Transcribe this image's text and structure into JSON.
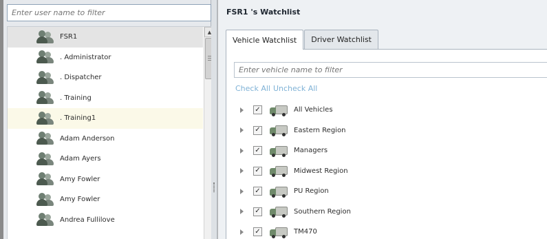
{
  "user_panel": {
    "filter_placeholder": "Enter user name to filter",
    "users": [
      {
        "label": "FSR1",
        "state": "selected"
      },
      {
        "label": ". Administrator",
        "state": ""
      },
      {
        "label": ". Dispatcher",
        "state": ""
      },
      {
        "label": ". Training",
        "state": ""
      },
      {
        "label": ". Training1",
        "state": "hover"
      },
      {
        "label": "Adam Anderson",
        "state": ""
      },
      {
        "label": "Adam Ayers",
        "state": ""
      },
      {
        "label": "Amy Fowler",
        "state": ""
      },
      {
        "label": "Amy Fowler",
        "state": ""
      },
      {
        "label": "Andrea Fullilove",
        "state": ""
      }
    ],
    "scroll_up_glyph": "▲"
  },
  "watchlist": {
    "title": "FSR1 's Watchlist",
    "tabs": [
      {
        "label": "Vehicle Watchlist",
        "active": true
      },
      {
        "label": "Driver Watchlist",
        "active": false
      }
    ],
    "vehicle_filter_placeholder": "Enter vehicle name to filter",
    "check_all_label": "Check All",
    "uncheck_all_label": "Uncheck All",
    "check_glyph": "✓",
    "groups": [
      {
        "label": "All Vehicles",
        "checked": true
      },
      {
        "label": "Eastern Region",
        "checked": true
      },
      {
        "label": "Managers",
        "checked": true
      },
      {
        "label": "Midwest Region",
        "checked": true
      },
      {
        "label": "PU Region",
        "checked": true
      },
      {
        "label": "Southern Region",
        "checked": true
      },
      {
        "label": "TM470",
        "checked": true
      }
    ]
  },
  "colors": {
    "link": "#7fb2d6",
    "selected_row": "#e4e4e4",
    "hover_row": "#fbf9e8"
  },
  "icons": {
    "user": "users-group-icon",
    "vehicle": "vehicle-truck-icon",
    "expander": "triangle-right-icon"
  }
}
